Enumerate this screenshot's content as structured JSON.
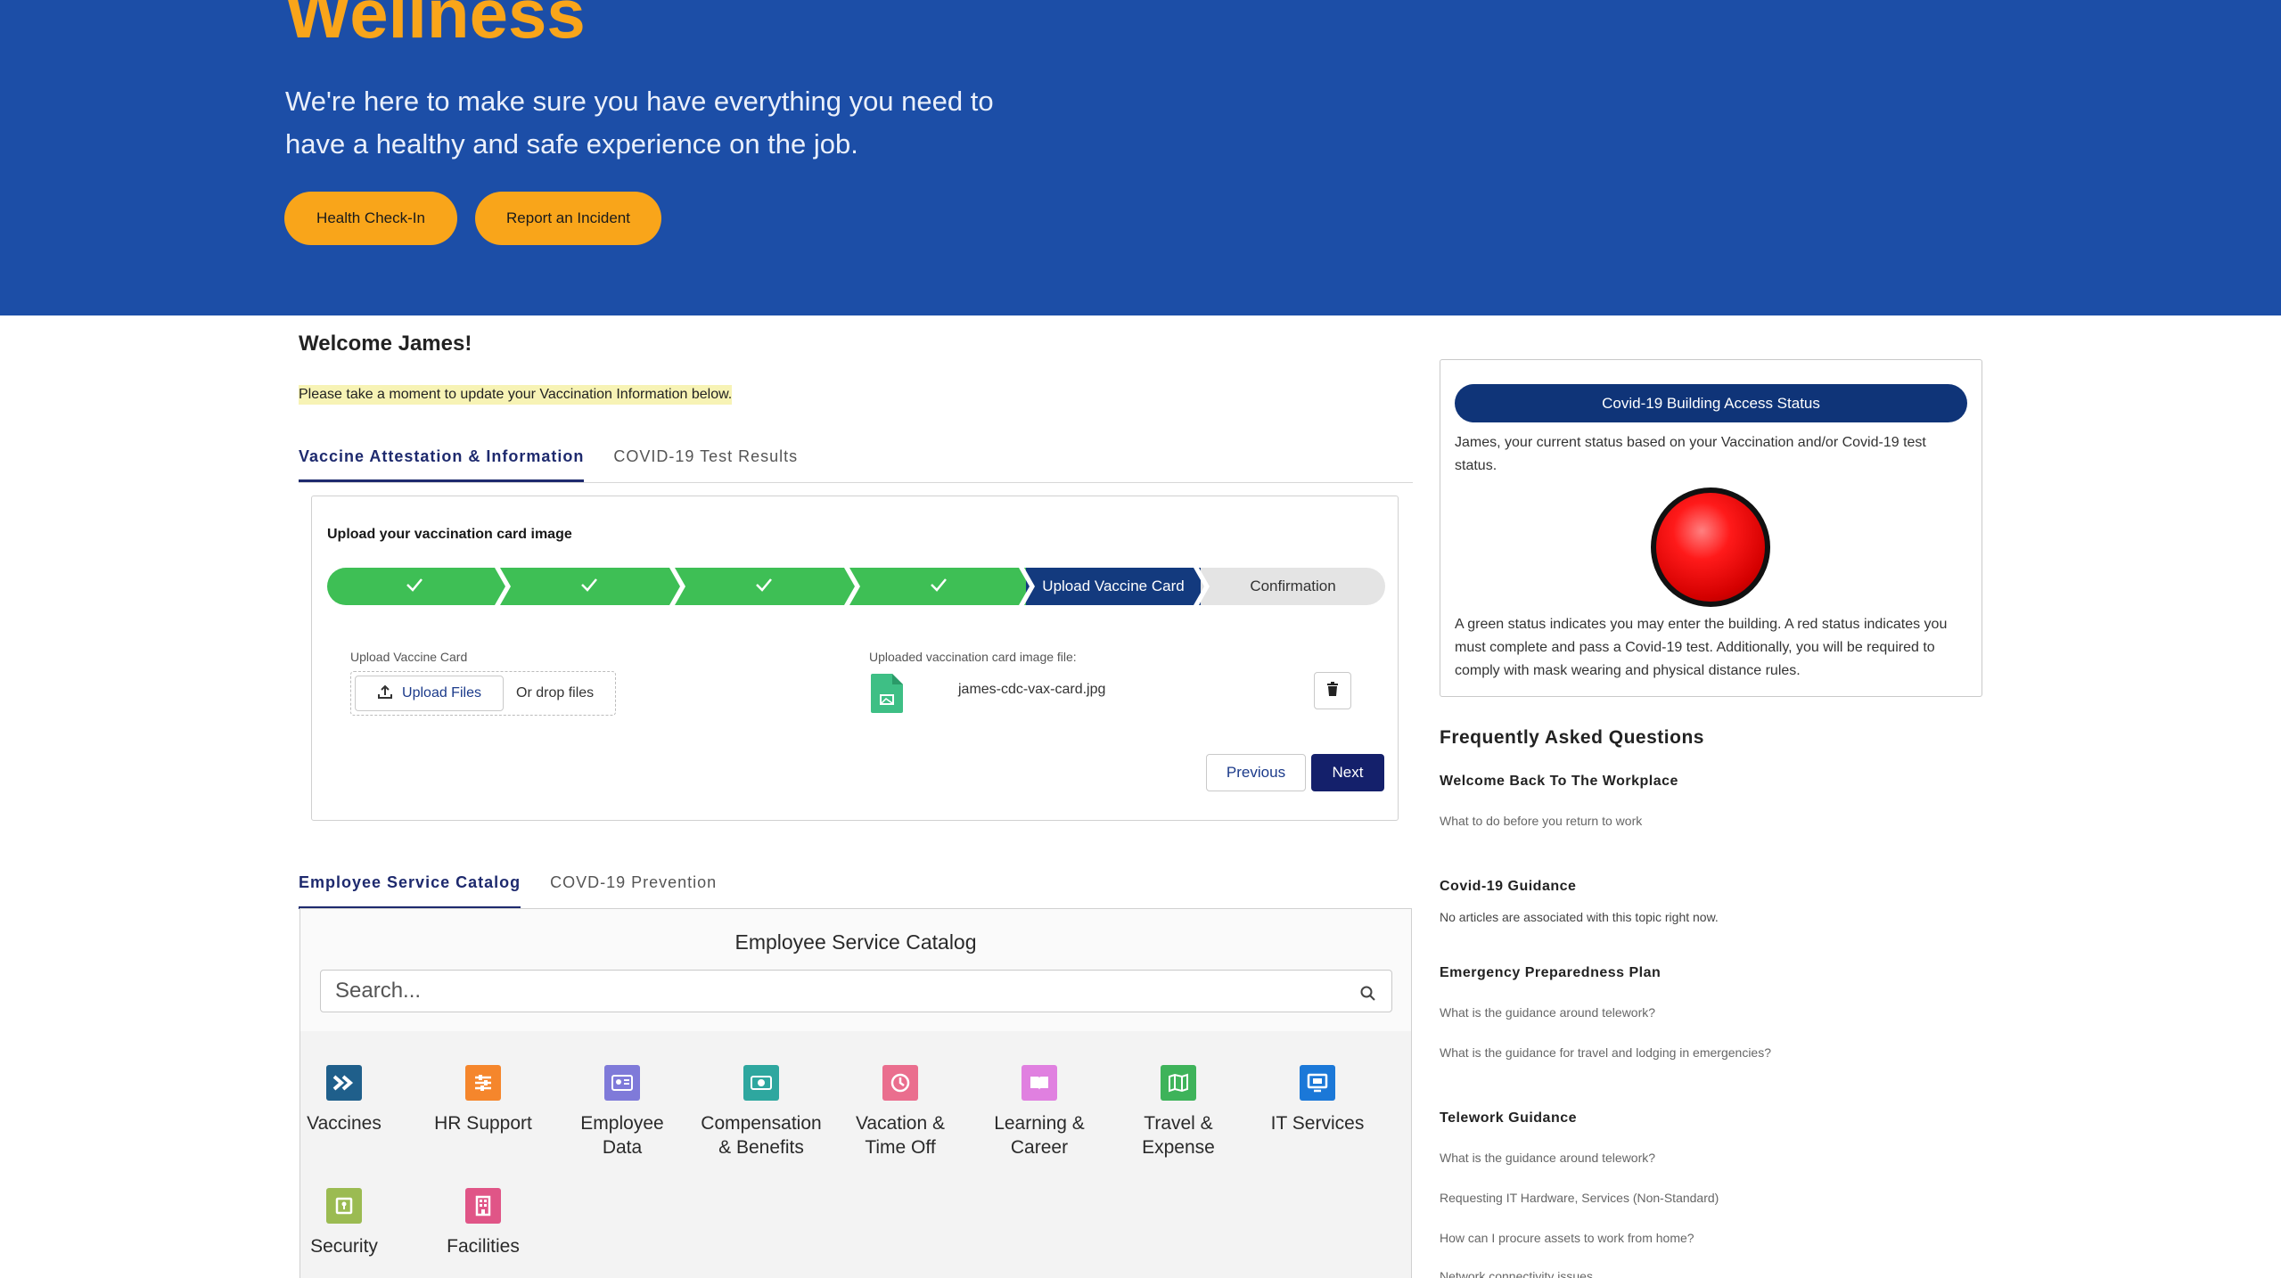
{
  "hero": {
    "title": "Wellness",
    "subtitle": "We're here to make sure you have everything you need to have a healthy and safe experience on the job.",
    "buttons": [
      "Health Check-In",
      "Report an Incident"
    ]
  },
  "welcome": {
    "greeting": "Welcome James!",
    "notice": "Please take a moment to update your Vaccination Information below."
  },
  "vaccine_tabs": [
    "Vaccine Attestation & Information",
    "COVID-19 Test Results"
  ],
  "vaccine_panel": {
    "title": "Upload your vaccination card image",
    "stages": [
      {
        "label": "",
        "state": "done"
      },
      {
        "label": "",
        "state": "done"
      },
      {
        "label": "",
        "state": "done"
      },
      {
        "label": "",
        "state": "done"
      },
      {
        "label": "Upload Vaccine Card",
        "state": "current"
      },
      {
        "label": "Confirmation",
        "state": "todo"
      }
    ],
    "upload_label": "Upload Vaccine Card",
    "upload_button": "Upload Files",
    "drop_text": "Or drop files",
    "uploaded_label": "Uploaded vaccination card image file:",
    "file_name": "james-cdc-vax-card.jpg",
    "previous": "Previous",
    "next": "Next"
  },
  "catalog_tabs": [
    "Employee Service Catalog",
    "COVD-19 Prevention"
  ],
  "catalog": {
    "title": "Employee Service Catalog",
    "search_placeholder": "Search...",
    "items": [
      {
        "label": "Vaccines",
        "icon": "vaccines-icon",
        "color": "#1f5f8b"
      },
      {
        "label": "HR Support",
        "icon": "hr-support-icon",
        "color": "#f5862c"
      },
      {
        "label": "Employee Data",
        "icon": "employee-data-icon",
        "color": "#7f7ad9"
      },
      {
        "label": "Compensation & Benefits",
        "icon": "compensation-icon",
        "color": "#2ea79f"
      },
      {
        "label": "Vacation & Time Off",
        "icon": "vacation-icon",
        "color": "#ea6e8e"
      },
      {
        "label": "Learning & Career",
        "icon": "learning-icon",
        "color": "#e080e0"
      },
      {
        "label": "Travel & Expense",
        "icon": "travel-icon",
        "color": "#3eb35a"
      },
      {
        "label": "IT Services",
        "icon": "it-services-icon",
        "color": "#1b78d8"
      },
      {
        "label": "Security",
        "icon": "security-icon",
        "color": "#9bbb52"
      },
      {
        "label": "Facilities",
        "icon": "facilities-icon",
        "color": "#e05587"
      }
    ]
  },
  "status_card": {
    "pill": "Covid-19 Building Access Status",
    "text": "James, your current status based on your Vaccination and/or Covid-19 test status.",
    "status": "red",
    "note": "A green status indicates you may enter the building. A red status indicates you must complete and pass a Covid-19 test. Additionally, you will be required to comply with mask wearing and physical distance rules."
  },
  "faq": {
    "title": "Frequently Asked Questions",
    "sections": [
      {
        "heading": "Welcome Back To The Workplace",
        "links": [
          "What to do before you return to work"
        ]
      },
      {
        "heading": "Covid-19 Guidance",
        "note": "No articles are associated with this topic right now."
      },
      {
        "heading": "Emergency Preparedness Plan",
        "links": [
          "What is the guidance around telework?",
          "What is the guidance for travel and lodging in emergencies?"
        ]
      },
      {
        "heading": "Telework Guidance",
        "links": [
          "What is the guidance around telework?",
          "Requesting IT Hardware, Services (Non-Standard)",
          "How can I procure assets to work from home?",
          "Network connectivity issues"
        ]
      }
    ]
  }
}
